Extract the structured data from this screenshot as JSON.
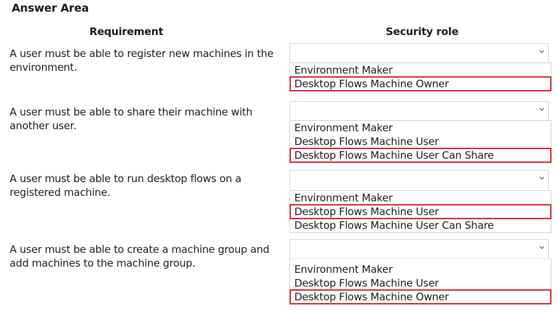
{
  "answer_area": {
    "title": "Answer Area"
  },
  "headers": {
    "requirement": "Requirement",
    "security_role": "Security role"
  },
  "rows": [
    {
      "requirement": "A user must be able to register new machines in the environment.",
      "options": [
        "Environment Maker",
        "Desktop Flows Machine Owner"
      ],
      "selected": "Desktop Flows Machine Owner"
    },
    {
      "requirement": "A user must be able to share their machine with another user.",
      "options": [
        "Environment Maker",
        "Desktop Flows Machine User",
        "Desktop Flows Machine User Can Share"
      ],
      "selected": "Desktop Flows Machine User Can Share"
    },
    {
      "requirement": "A user must be able to run desktop flows on a registered machine.",
      "options": [
        "Environment Maker",
        "Desktop Flows Machine User",
        "Desktop Flows Machine User Can Share"
      ],
      "selected": "Desktop Flows Machine User"
    },
    {
      "requirement": "A user must be able to create a machine group and add machines to the machine group.",
      "options": [
        "Environment Maker",
        "Desktop Flows Machine User",
        "Desktop Flows Machine Owner"
      ],
      "selected": "Desktop Flows Machine Owner"
    }
  ],
  "colors": {
    "highlight": "#d9232d",
    "border": "#d4d4d4"
  },
  "icons": {
    "dropdown": "chevron-down-icon"
  }
}
